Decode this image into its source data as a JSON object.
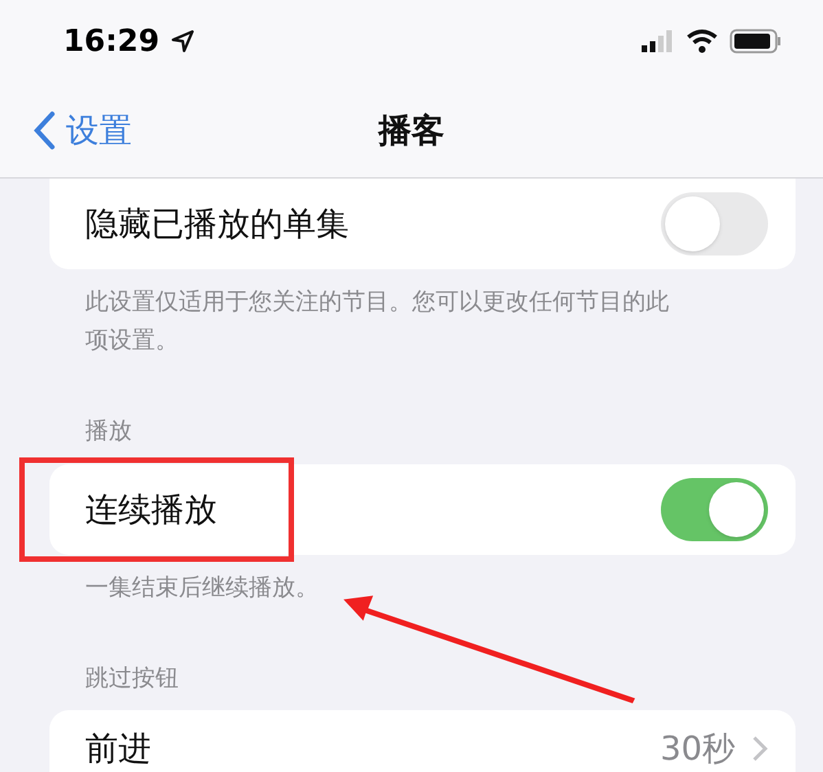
{
  "status_bar": {
    "time": "16:29"
  },
  "nav": {
    "back": "设置",
    "title": "播客"
  },
  "sections": [
    {
      "rows": [
        {
          "kind": "toggle",
          "label": "隐藏已播放的单集",
          "on": false
        }
      ],
      "footer": "此设置仅适用于您关注的节目。您可以更改任何节目的此项设置。"
    },
    {
      "header": "播放",
      "rows": [
        {
          "kind": "toggle",
          "label": "连续播放",
          "on": true
        }
      ],
      "footer": "一集结束后继续播放。"
    },
    {
      "header": "跳过按钮",
      "rows": [
        {
          "kind": "value",
          "label": "前进",
          "value": "30秒"
        }
      ]
    }
  ]
}
